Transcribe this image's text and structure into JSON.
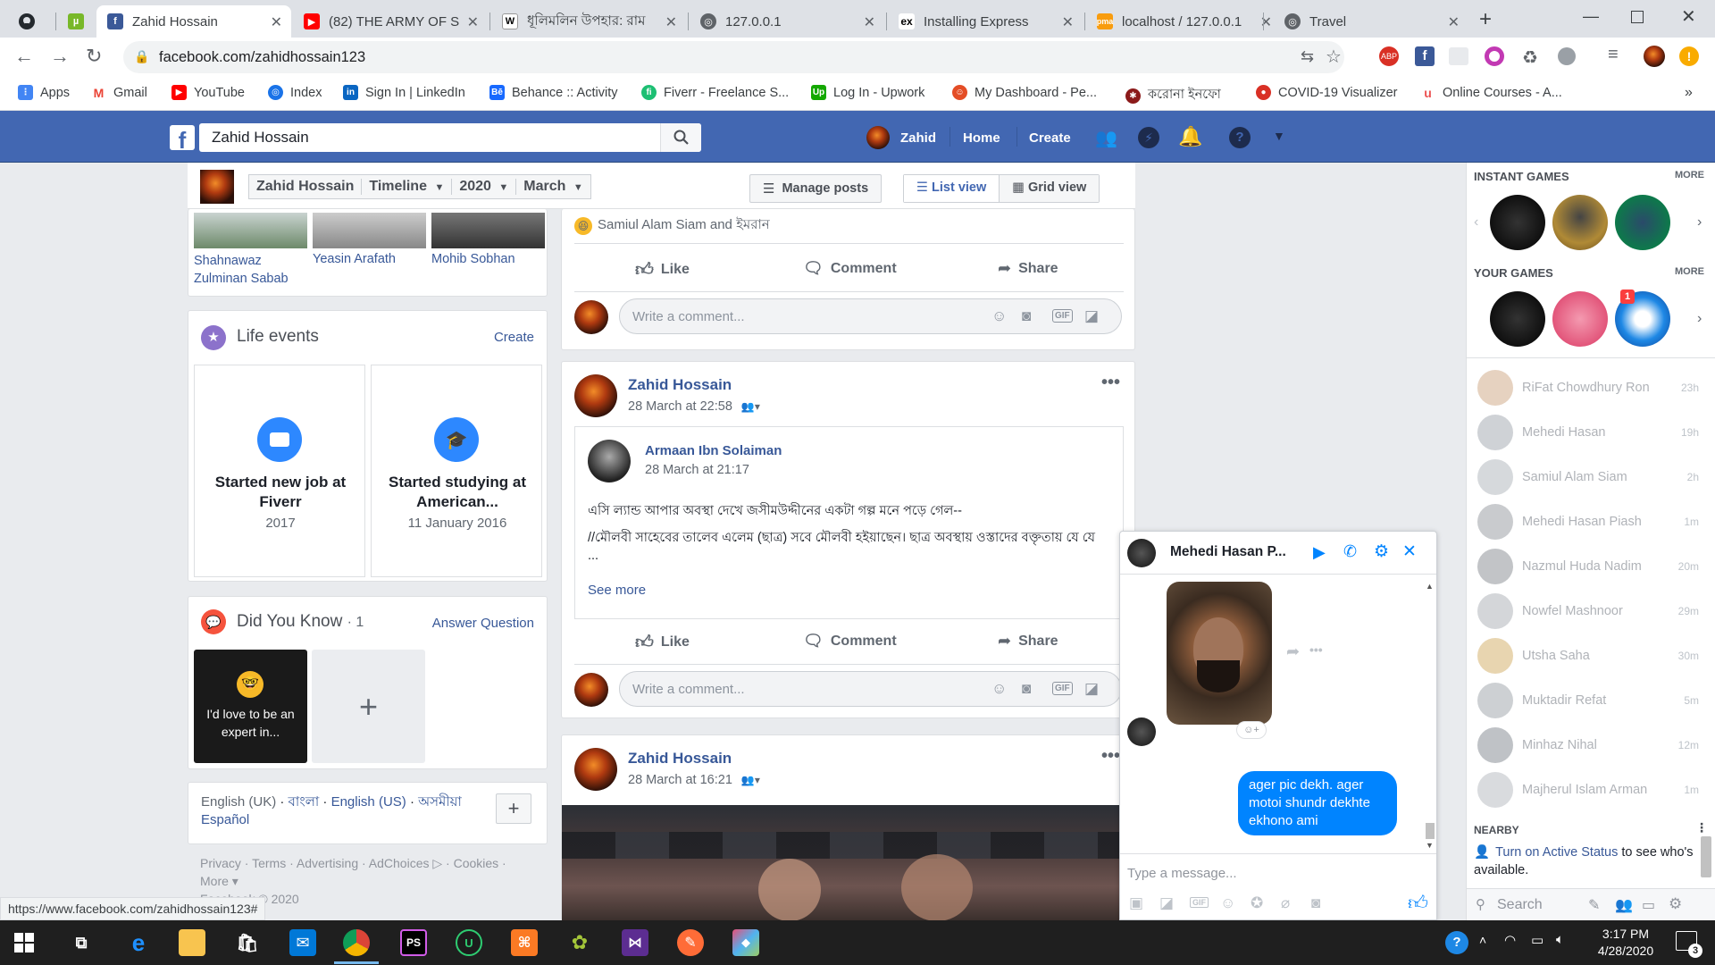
{
  "browser": {
    "tabs": [
      {
        "label": "",
        "icon": "github-icon"
      },
      {
        "label": "",
        "icon": "utorrent-icon"
      },
      {
        "label": "Zahid Hossain",
        "icon": "facebook-icon"
      },
      {
        "label": "(82) THE ARMY OF S",
        "icon": "youtube-icon"
      },
      {
        "label": "ধূলিমলিন উপহার: রাম",
        "icon": "wikipedia-icon"
      },
      {
        "label": "127.0.0.1",
        "icon": "globe-icon"
      },
      {
        "label": "Installing Express",
        "icon": "express-icon"
      },
      {
        "label": "localhost / 127.0.0.1",
        "icon": "phpmyadmin-icon"
      },
      {
        "label": "Travel",
        "icon": "globe-icon"
      }
    ],
    "new_tab": "+",
    "url": "facebook.com/zahidhossain123",
    "bookmarks": [
      {
        "label": "Apps",
        "color": "#4285f4"
      },
      {
        "label": "Gmail",
        "color": "#ea4335"
      },
      {
        "label": "YouTube",
        "color": "#ff0000"
      },
      {
        "label": "Index",
        "color": "#1a73e8"
      },
      {
        "label": "Sign In | LinkedIn",
        "color": "#0a66c2"
      },
      {
        "label": "Behance :: Activity",
        "color": "#1769ff"
      },
      {
        "label": "Fiverr - Freelance S...",
        "color": "#1dbf73"
      },
      {
        "label": "Log In - Upwork",
        "color": "#14a800"
      },
      {
        "label": "My Dashboard - Pe...",
        "color": "#e44d26"
      },
      {
        "label": "করোনা ইনফো",
        "color": "#8b1a1a"
      },
      {
        "label": "COVID-19 Visualizer",
        "color": "#d93025"
      },
      {
        "label": "Online Courses - A...",
        "color": "#ec5252"
      }
    ],
    "bookmarks_more": "»",
    "status_url": "https://www.facebook.com/zahidhossain123#"
  },
  "fb_header": {
    "search_value": "Zahid Hossain",
    "profile_name": "Zahid",
    "home": "Home",
    "create": "Create",
    "brand_color": "#4267b2"
  },
  "timeline_bar": {
    "name": "Zahid Hossain",
    "timeline": "Timeline",
    "year": "2020",
    "month": "March",
    "manage_posts": "Manage posts",
    "list_view": "List view",
    "grid_view": "Grid view"
  },
  "friends": [
    {
      "name": "Shahnawaz Zulminan Sabab"
    },
    {
      "name": "Yeasin Arafath"
    },
    {
      "name": "Mohib Sobhan"
    }
  ],
  "life_events": {
    "title": "Life events",
    "create": "Create",
    "items": [
      {
        "title": "Started new job at Fiverr",
        "date": "2017"
      },
      {
        "title": "Started studying at American...",
        "date": "11 January 2016"
      }
    ]
  },
  "did_you_know": {
    "title": "Did You Know",
    "count": "· 1",
    "answer": "Answer Question",
    "card_text": "I'd love to be an expert in...",
    "add": "+"
  },
  "languages": {
    "items": [
      "English (UK)",
      "বাংলা",
      "English (US)",
      "অসমীয়া",
      "Español"
    ],
    "add": "+"
  },
  "footer_links": {
    "line1": "Privacy · Terms · Advertising · AdChoices ▷ · Cookies ·",
    "line2": "More ▾",
    "line3": "Facebook © 2020"
  },
  "posts": {
    "reactions_text": "Samiul Alam Siam and ইমরান",
    "like": "Like",
    "comment": "Comment",
    "share": "Share",
    "comment_placeholder": "Write a comment...",
    "post1": {
      "author": "Zahid Hossain",
      "time": "28 March at 22:58",
      "shared_author": "Armaan Ibn Solaiman",
      "shared_time": "28 March at 21:17",
      "text1": "এসি ল্যান্ড আপার অবস্থা দেখে জসীমউদ্দীনের একটা গল্প মনে পড়ে গেল--",
      "text2": "//মৌলবী সাহেবের তালেব এলেম (ছাত্র) সবে মৌলবী হইয়াছেন। ছাত্র অবস্থায় ওস্তাদের বক্তৃতায় যে যে ...",
      "see_more": "See more"
    },
    "post2": {
      "author": "Zahid Hossain",
      "time": "28 March at 16:21"
    }
  },
  "rail": {
    "instant_games": "INSTANT GAMES",
    "your_games": "YOUR GAMES",
    "more": "MORE",
    "game_badge": "1",
    "contacts": [
      {
        "name": "RiFat Chowdhury Ron",
        "time": "23h"
      },
      {
        "name": "Mehedi Hasan",
        "time": "19h"
      },
      {
        "name": "Samiul Alam Siam",
        "time": "2h"
      },
      {
        "name": "Mehedi Hasan Piash",
        "time": "1m"
      },
      {
        "name": "Nazmul Huda Nadim",
        "time": "20m"
      },
      {
        "name": "Nowfel Mashnoor",
        "time": "29m"
      },
      {
        "name": "Utsha Saha",
        "time": "30m"
      },
      {
        "name": "Muktadir Refat",
        "time": "5m"
      },
      {
        "name": "Minhaz Nihal",
        "time": "12m"
      },
      {
        "name": "Majherul Islam Arman",
        "time": "1m"
      }
    ],
    "nearby": "NEARBY",
    "active_status_link": "Turn on Active Status",
    "active_status_text": "to see who's available.",
    "search": "Search"
  },
  "chat": {
    "name": "Mehedi Hasan P...",
    "message": "ager pic dekh. ager motoi shundr dekhte ekhono ami",
    "placeholder": "Type a message...",
    "accent": "#0084ff"
  },
  "taskbar": {
    "time": "3:17 PM",
    "date": "4/28/2020",
    "notif_count": "3"
  }
}
